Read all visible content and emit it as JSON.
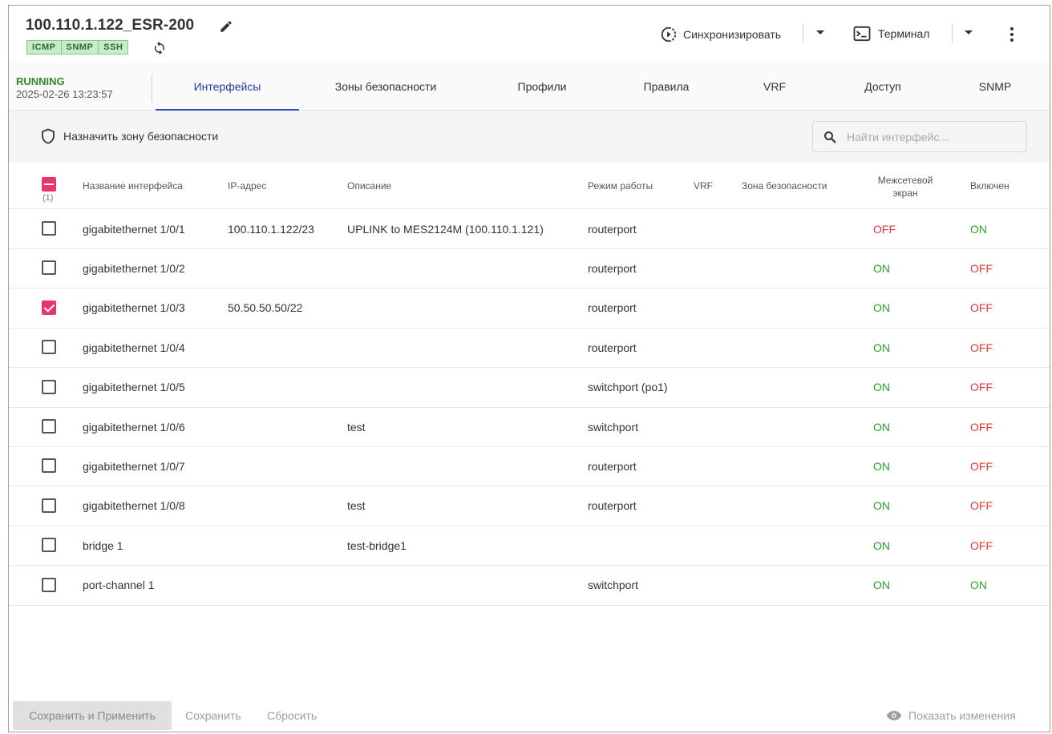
{
  "device": {
    "title": "100.110.1.122_ESR-200",
    "badges": [
      "ICMP",
      "SNMP",
      "SSH"
    ],
    "state": "RUNNING",
    "date": "2025-02-26 13:23:57"
  },
  "actions": {
    "sync_label": "Синхронизировать",
    "terminal_label": "Терминал"
  },
  "tabs": [
    {
      "label": "Интерфейсы",
      "active": true
    },
    {
      "label": "Зоны безопасности",
      "active": false
    },
    {
      "label": "Профили",
      "active": false
    },
    {
      "label": "Правила",
      "active": false
    },
    {
      "label": "VRF",
      "active": false
    },
    {
      "label": "Доступ",
      "active": false
    },
    {
      "label": "SNMP",
      "active": false
    }
  ],
  "toolbar": {
    "assign_label": "Назначить зону безопасности",
    "search_placeholder": "Найти интерфейс..."
  },
  "table": {
    "selected_count": "(1)",
    "columns": {
      "name": "Название интерфейса",
      "ip": "IP-адрес",
      "desc": "Описание",
      "mode": "Режим работы",
      "vrf": "VRF",
      "zone": "Зона безопасности",
      "firewall": "Межсетевой экран",
      "enabled": "Включен"
    },
    "rows": [
      {
        "checked": false,
        "name": "gigabitethernet 1/0/1",
        "ip": "100.110.1.122/23",
        "desc": "UPLINK to MES2124M (100.110.1.121)",
        "mode": "routerport",
        "vrf": "",
        "zone": "",
        "firewall": "OFF",
        "enabled": "ON"
      },
      {
        "checked": false,
        "name": "gigabitethernet 1/0/2",
        "ip": "",
        "desc": "",
        "mode": "routerport",
        "vrf": "",
        "zone": "",
        "firewall": "ON",
        "enabled": "OFF"
      },
      {
        "checked": true,
        "name": "gigabitethernet 1/0/3",
        "ip": "50.50.50.50/22",
        "desc": "",
        "mode": "routerport",
        "vrf": "",
        "zone": "",
        "firewall": "ON",
        "enabled": "OFF"
      },
      {
        "checked": false,
        "name": "gigabitethernet 1/0/4",
        "ip": "",
        "desc": "",
        "mode": "routerport",
        "vrf": "",
        "zone": "",
        "firewall": "ON",
        "enabled": "OFF"
      },
      {
        "checked": false,
        "name": "gigabitethernet 1/0/5",
        "ip": "",
        "desc": "",
        "mode": "switchport (po1)",
        "vrf": "",
        "zone": "",
        "firewall": "ON",
        "enabled": "OFF"
      },
      {
        "checked": false,
        "name": "gigabitethernet 1/0/6",
        "ip": "",
        "desc": "test",
        "mode": "switchport",
        "vrf": "",
        "zone": "",
        "firewall": "ON",
        "enabled": "OFF"
      },
      {
        "checked": false,
        "name": "gigabitethernet 1/0/7",
        "ip": "",
        "desc": "",
        "mode": "routerport",
        "vrf": "",
        "zone": "",
        "firewall": "ON",
        "enabled": "OFF"
      },
      {
        "checked": false,
        "name": "gigabitethernet 1/0/8",
        "ip": "",
        "desc": "test",
        "mode": "routerport",
        "vrf": "",
        "zone": "",
        "firewall": "ON",
        "enabled": "OFF"
      },
      {
        "checked": false,
        "name": "bridge 1",
        "ip": "",
        "desc": "test-bridge1",
        "mode": "",
        "vrf": "",
        "zone": "",
        "firewall": "ON",
        "enabled": "OFF"
      },
      {
        "checked": false,
        "name": "port-channel 1",
        "ip": "",
        "desc": "",
        "mode": "switchport",
        "vrf": "",
        "zone": "",
        "firewall": "ON",
        "enabled": "ON"
      }
    ]
  },
  "footer": {
    "save_apply_label": "Сохранить и Применить",
    "save_label": "Сохранить",
    "reset_label": "Сбросить",
    "show_changes_label": "Показать изменения"
  },
  "colors": {
    "on": "#2e9e2e",
    "off": "#e53935",
    "accent": "#2c4fb8",
    "check": "#e8356e",
    "running": "#2e8b2e"
  }
}
